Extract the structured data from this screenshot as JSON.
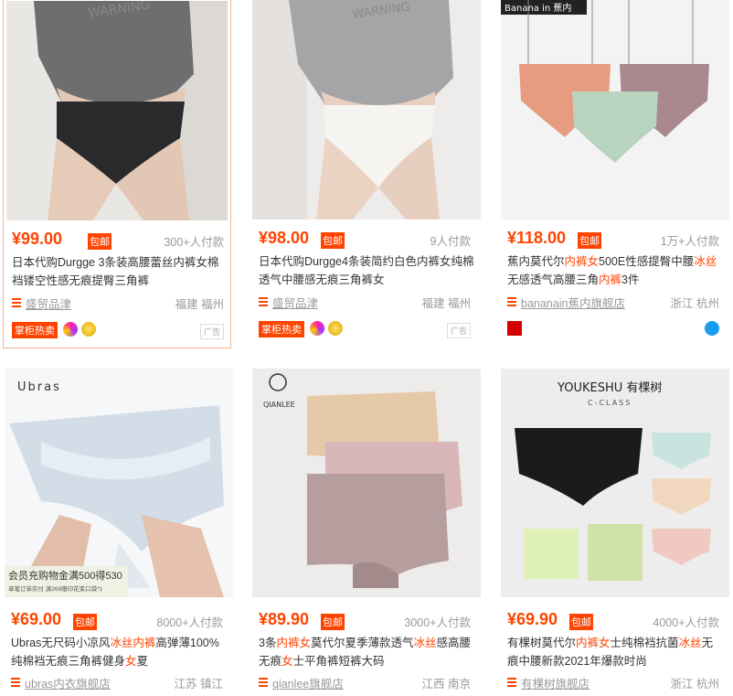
{
  "products": [
    {
      "price": "¥99.00",
      "badge": "包邮",
      "sold": "300+人付款",
      "title_parts": [
        "日本代购Durgge 3条装高腰蕾丝内裤女棉裆镂空性感无痕提臀三角裤"
      ],
      "shop": "盛贸品津",
      "location": "福建 福州",
      "tag": "掌柜热卖",
      "ad": "广告"
    },
    {
      "price": "¥98.00",
      "badge": "包邮",
      "sold": "9人付款",
      "title_parts": [
        "日本代购Durgge4条装简约白色内裤女纯棉透气中腰感无痕三角裤女"
      ],
      "shop": "盛贸品津",
      "location": "福建 福州",
      "tag": "掌柜热卖",
      "ad": "广告"
    },
    {
      "brand_text": "Banana in 蕉内",
      "price": "¥118.00",
      "badge": "包邮",
      "sold": "1万+人付款",
      "title_parts": [
        "蕉内莫代尔",
        "内裤女",
        "500E性感提臀中腰",
        "冰丝",
        "无感透气高腰三角",
        "内裤",
        "3件"
      ],
      "shop": "bananain蕉内旗舰店",
      "location": "浙江 杭州"
    },
    {
      "brand_text": "Ubras",
      "promo_main": "会员充购物金满500得530",
      "promo_sub": "单笔订单实付 满269赠印花束口袋*1",
      "price": "¥69.00",
      "badge": "包邮",
      "sold": "8000+人付款",
      "title_parts": [
        "Ubras无尺码小凉风",
        "冰丝内裤",
        "高弹薄100%纯棉裆无痕三角裤健身",
        "女",
        "夏"
      ],
      "shop": "ubras内衣旗舰店",
      "location": "江苏 镇江"
    },
    {
      "brand_text": "QIANLEE",
      "price": "¥89.90",
      "badge": "包邮",
      "sold": "3000+人付款",
      "title_parts": [
        "3条",
        "内裤女",
        "莫代尔夏季薄款透气",
        "冰丝",
        "感高腰无痕",
        "女",
        "士平角裤短裤大码"
      ],
      "shop": "qianlee旗舰店",
      "location": "江西 南京"
    },
    {
      "brand_text": "YOUKESHU 有棵树",
      "brand_sub": "C-CLASS",
      "price": "¥69.90",
      "badge": "包邮",
      "sold": "4000+人付款",
      "title_parts": [
        "有棵树莫代尔",
        "内裤女",
        "士纯棉裆抗菌",
        "冰丝",
        "无痕中腰新款2021年爆款时尚"
      ],
      "shop": "有棵树旗舰店",
      "location": "浙江 杭州"
    }
  ],
  "colors": {
    "accent": "#ff4400",
    "muted": "#999999"
  }
}
